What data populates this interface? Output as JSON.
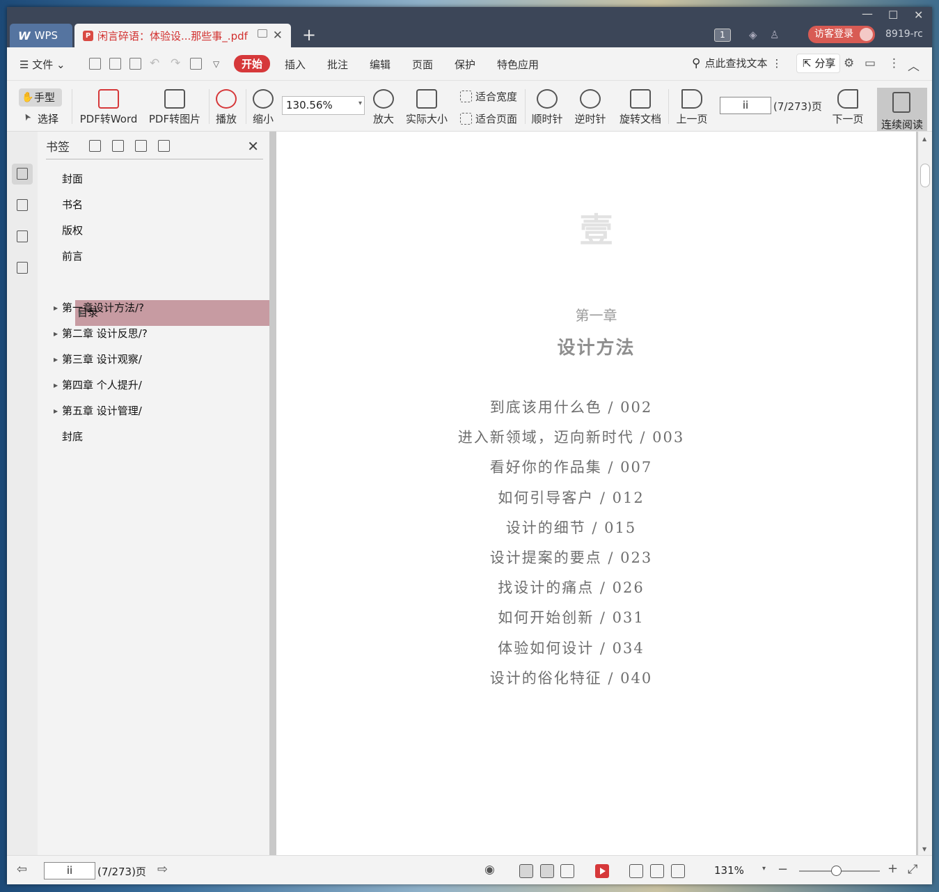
{
  "tabs": {
    "app": "WPS",
    "doc": "闲言碎语：体验设...那些事_.pdf"
  },
  "header": {
    "badge": "1",
    "login": "访客登录",
    "user": "8919-rc"
  },
  "menu": {
    "file": "文件",
    "items": [
      "开始",
      "插入",
      "批注",
      "编辑",
      "页面",
      "保护",
      "特色应用"
    ],
    "search": "点此查找文本",
    "share": "分享"
  },
  "toolbar": {
    "hand": "手型",
    "select": "选择",
    "pdf2word": "PDF转Word",
    "pdf2img": "PDF转图片",
    "play": "播放",
    "zoomout": "缩小",
    "zoom_value": "130.56%",
    "zoomin": "放大",
    "actual": "实际大小",
    "fitwidth": "适合宽度",
    "fitpage": "适合页面",
    "cw": "顺时针",
    "ccw": "逆时针",
    "rotate": "旋转文档",
    "prev": "上一页",
    "page_value": "ii",
    "page_count": "(7/273)页",
    "next": "下一页",
    "continuous": "连续阅读"
  },
  "bookmarks": {
    "title": "书签",
    "items": [
      {
        "label": "封面",
        "expandable": false,
        "selected": false
      },
      {
        "label": "书名",
        "expandable": false,
        "selected": false
      },
      {
        "label": "版权",
        "expandable": false,
        "selected": false
      },
      {
        "label": "前言",
        "expandable": false,
        "selected": false
      },
      {
        "label": "目录",
        "expandable": false,
        "selected": true
      },
      {
        "label": "第一章设计方法/?",
        "expandable": true,
        "selected": false
      },
      {
        "label": "第二章 设计反思/?",
        "expandable": true,
        "selected": false
      },
      {
        "label": "第三章 设计观察/",
        "expandable": true,
        "selected": false
      },
      {
        "label": "第四章 个人提升/",
        "expandable": true,
        "selected": false
      },
      {
        "label": "第五章 设计管理/",
        "expandable": true,
        "selected": false
      },
      {
        "label": "封底",
        "expandable": false,
        "selected": false
      }
    ]
  },
  "page": {
    "big_char": "壹",
    "chapter": "第一章",
    "chapter_title": "设计方法",
    "toc": [
      "到底该用什么色 / 002",
      "进入新领域，迈向新时代 / 003",
      "看好你的作品集 / 007",
      "如何引导客户 / 012",
      "设计的细节 / 015",
      "设计提案的要点 / 023",
      "找设计的痛点 / 026",
      "如何开始创新 / 031",
      "体验如何设计 / 034",
      "设计的俗化特征 / 040"
    ]
  },
  "status": {
    "page_value": "ii",
    "page_count": "(7/273)页",
    "zoom": "131%"
  }
}
